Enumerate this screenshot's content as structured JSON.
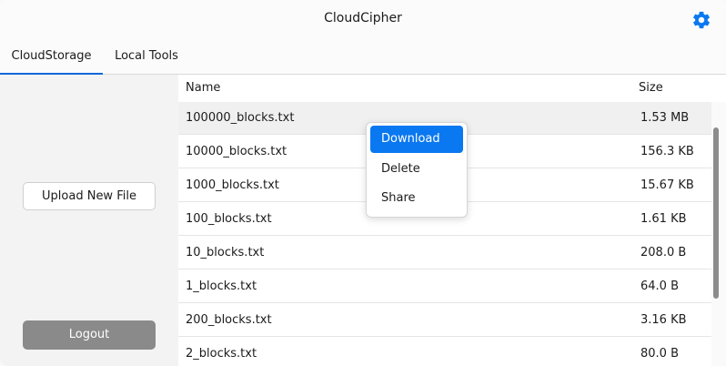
{
  "app": {
    "title": "CloudCipher",
    "settings_icon": "gear-icon",
    "accent_color": "#0a78f0"
  },
  "tabs": [
    {
      "label": "CloudStorage",
      "active": true
    },
    {
      "label": "Local Tools",
      "active": false
    }
  ],
  "sidebar": {
    "upload_label": "Upload New File",
    "logout_label": "Logout"
  },
  "table": {
    "columns": [
      "Name",
      "Size"
    ],
    "rows": [
      {
        "name": "100000_blocks.txt",
        "size": "1.53 MB",
        "selected": true
      },
      {
        "name": "10000_blocks.txt",
        "size": "156.3 KB"
      },
      {
        "name": "1000_blocks.txt",
        "size": "15.67 KB"
      },
      {
        "name": "100_blocks.txt",
        "size": "1.61 KB"
      },
      {
        "name": "10_blocks.txt",
        "size": "208.0 B"
      },
      {
        "name": "1_blocks.txt",
        "size": "64.0 B"
      },
      {
        "name": "200_blocks.txt",
        "size": "3.16 KB"
      },
      {
        "name": "2_blocks.txt",
        "size": "80.0 B"
      }
    ]
  },
  "context_menu": {
    "items": [
      {
        "label": "Download",
        "highlighted": true
      },
      {
        "label": "Delete"
      },
      {
        "label": "Share"
      }
    ]
  }
}
